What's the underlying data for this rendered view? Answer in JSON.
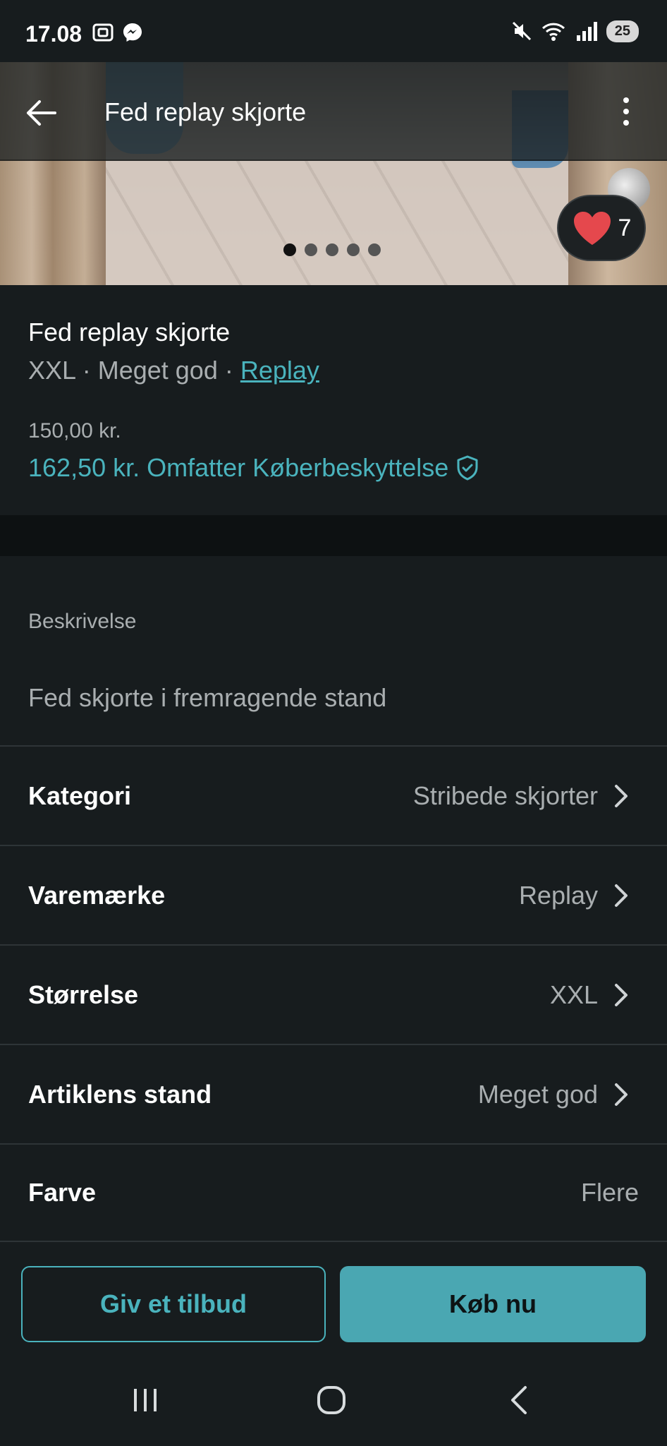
{
  "status_bar": {
    "time": "17.08",
    "battery": "25"
  },
  "header": {
    "title": "Fed replay skjorte"
  },
  "gallery": {
    "total_images": 5,
    "active_index": 0
  },
  "favorite": {
    "count": "7"
  },
  "item": {
    "title": "Fed replay skjorte",
    "size": "XXL",
    "condition": "Meget god",
    "brand": "Replay",
    "separator": " · ",
    "price": "150,00 kr.",
    "total_price": "162,50 kr.",
    "protection_label": "Omfatter Køberbeskyttelse"
  },
  "description": {
    "label": "Beskrivelse",
    "text": "Fed skjorte i fremragende stand"
  },
  "attributes": [
    {
      "label": "Kategori",
      "value": "Stribede skjorter"
    },
    {
      "label": "Varemærke",
      "value": "Replay"
    },
    {
      "label": "Størrelse",
      "value": "XXL"
    },
    {
      "label": "Artiklens stand",
      "value": "Meget god"
    },
    {
      "label": "Farve",
      "value": "Flere"
    }
  ],
  "actions": {
    "offer_label": "Giv et tilbud",
    "buy_label": "Køb nu"
  },
  "colors": {
    "accent": "#4ab3bd",
    "background": "#171c1e",
    "heart": "#e5484d"
  }
}
